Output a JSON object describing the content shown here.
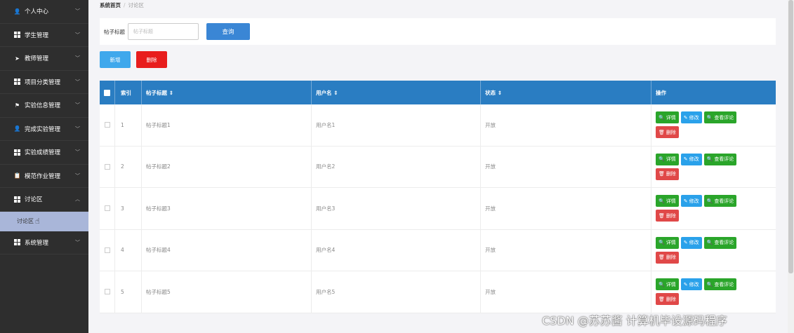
{
  "sidebar": {
    "items": [
      {
        "label": "个人中心",
        "icon": "user-icon"
      },
      {
        "label": "学生管理",
        "icon": "grid-icon"
      },
      {
        "label": "教师管理",
        "icon": "send-icon"
      },
      {
        "label": "项目分类管理",
        "icon": "grid-icon"
      },
      {
        "label": "实验信息管理",
        "icon": "flag-icon"
      },
      {
        "label": "完成实验管理",
        "icon": "user-icon"
      },
      {
        "label": "实验成绩管理",
        "icon": "grid-icon"
      },
      {
        "label": "模范作业管理",
        "icon": "clipboard-icon"
      },
      {
        "label": "讨论区",
        "icon": "grid-icon"
      }
    ],
    "active_sub": "讨论区",
    "last_item": {
      "label": "系统管理",
      "icon": "grid-icon"
    }
  },
  "breadcrumb": {
    "home": "系统首页",
    "current": "讨论区"
  },
  "search": {
    "label": "帖子标题",
    "placeholder": "帖子标题",
    "value": "",
    "button": "查询"
  },
  "actions": {
    "add": "新增",
    "delete": "删除"
  },
  "table": {
    "headers": {
      "index": "索引",
      "title": "帖子标题 ⇕",
      "username": "用户名 ⇕",
      "status": "状态 ⇕",
      "ops": "操作"
    },
    "rows": [
      {
        "index": "1",
        "title": "帖子标题1",
        "username": "用户名1",
        "status": "开放"
      },
      {
        "index": "2",
        "title": "帖子标题2",
        "username": "用户名2",
        "status": "开放"
      },
      {
        "index": "3",
        "title": "帖子标题3",
        "username": "用户名3",
        "status": "开放"
      },
      {
        "index": "4",
        "title": "帖子标题4",
        "username": "用户名4",
        "status": "开放"
      },
      {
        "index": "5",
        "title": "帖子标题5",
        "username": "用户名5",
        "status": "开放"
      }
    ],
    "op_labels": {
      "detail": "详情",
      "edit": "修改",
      "comments": "查看评论",
      "delete": "删除"
    }
  },
  "watermark": "CSDN @苏苏酱  计算机毕设源码程序",
  "colors": {
    "sidebar_bg": "#2e2e2e",
    "header_blue": "#2a7dc2",
    "query_blue": "#3a86d5",
    "add_blue": "#3fa8ec",
    "delete_red": "#e81d1d",
    "op_green": "#2aa52a"
  }
}
